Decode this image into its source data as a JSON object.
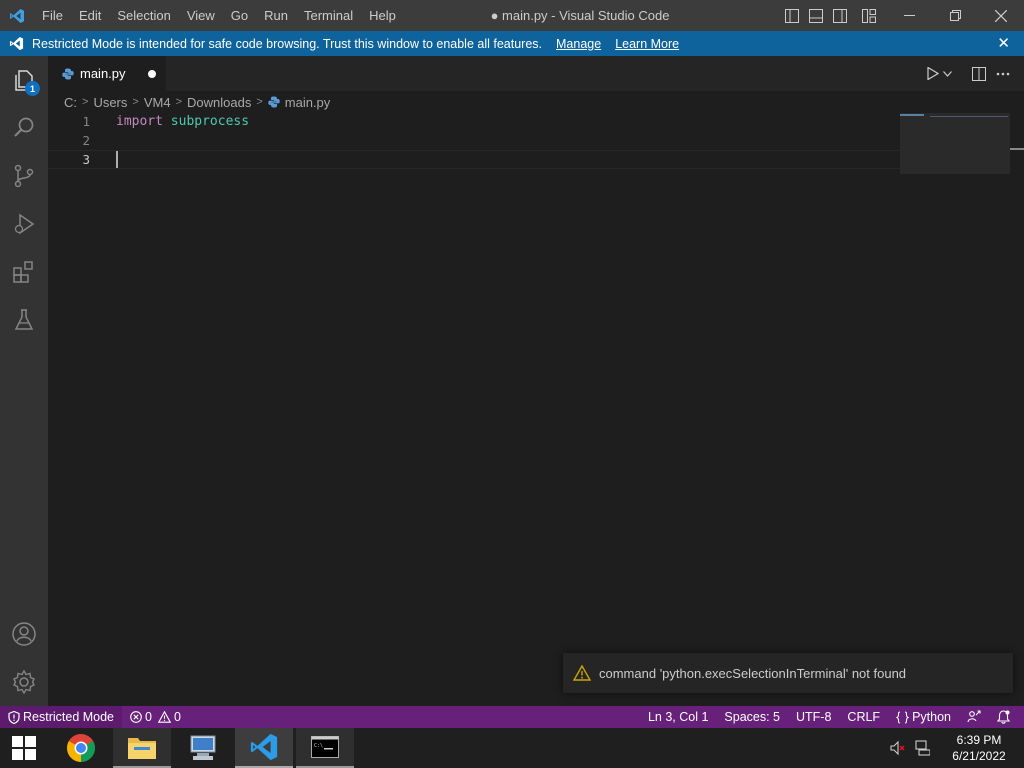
{
  "titlebar": {
    "menu": [
      "File",
      "Edit",
      "Selection",
      "View",
      "Go",
      "Run",
      "Terminal",
      "Help"
    ],
    "title": "● main.py - Visual Studio Code",
    "icons": [
      "vscode-logo-icon",
      "toggle-primary-sidebar-icon",
      "toggle-panel-icon",
      "toggle-secondary-sidebar-icon",
      "customize-layout-icon",
      "minimize-icon",
      "restore-icon",
      "close-icon"
    ]
  },
  "banner": {
    "message": "Restricted Mode is intended for safe code browsing. Trust this window to enable all features.",
    "manage": "Manage",
    "learn_more": "Learn More",
    "close": "✕"
  },
  "activitybar": {
    "explorer_badge": "1",
    "icons": [
      "explorer-icon",
      "search-icon",
      "source-control-icon",
      "run-debug-icon",
      "extensions-icon",
      "testing-icon",
      "accounts-icon",
      "manage-gear-icon"
    ]
  },
  "editor": {
    "tab": {
      "label": "main.py",
      "dirty": true
    },
    "breadcrumb": [
      "C:",
      "Users",
      "VM4",
      "Downloads",
      "main.py"
    ],
    "lines": [
      {
        "num": "1",
        "keyword": "import",
        "module": "subprocess"
      },
      {
        "num": "2",
        "keyword": "",
        "module": ""
      },
      {
        "num": "3",
        "keyword": "",
        "module": ""
      }
    ],
    "current_line": 3
  },
  "notification": {
    "text": "command 'python.execSelectionInTerminal' not found"
  },
  "statusbar": {
    "restricted": "Restricted Mode",
    "errors": "0",
    "warnings": "0",
    "position": "Ln 3, Col 1",
    "spaces": "Spaces: 5",
    "encoding": "UTF-8",
    "eol": "CRLF",
    "language": "Python"
  },
  "taskbar": {
    "apps": [
      "chrome-icon",
      "file-explorer-icon",
      "network-computer-icon",
      "vscode-icon",
      "command-prompt-icon"
    ],
    "time": "6:39 PM",
    "date": "6/21/2022"
  },
  "colors": {
    "banner": "#0e639c",
    "statusbar": "#68217a",
    "keyword": "#c586c0",
    "module": "#4ec9b0"
  }
}
